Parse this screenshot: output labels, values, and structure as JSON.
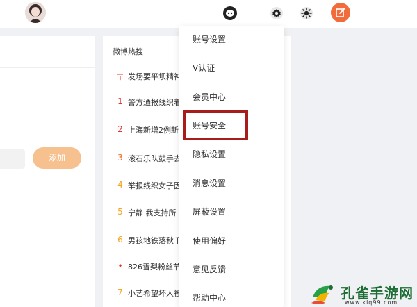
{
  "colors": {
    "accent": "#f26b3a",
    "add_button": "#f7c08f",
    "rank_color": "#f5a623",
    "top_rank": "#e2362d",
    "highlight_border": "#a81c1c",
    "watermark_green": "#1c6d33"
  },
  "topbar": {
    "icons": [
      "avatar",
      "message-icon",
      "gear-icon",
      "sun-icon",
      "compose-icon"
    ]
  },
  "left_panel": {
    "add_label": "添加"
  },
  "hot_search": {
    "title": "微博热搜",
    "items": [
      {
        "rank": "〒",
        "text": "发场要平坝精神"
      },
      {
        "rank": "1",
        "text": "警方通报线织着"
      },
      {
        "rank": "2",
        "text": "上海新增2例新"
      },
      {
        "rank": "3",
        "text": "滚石乐队鼓手去"
      },
      {
        "rank": "4",
        "text": "举报线织女子因"
      },
      {
        "rank": "5",
        "text": "宁静 我支持所"
      },
      {
        "rank": "6",
        "text": "男孩地铁落秋千"
      },
      {
        "rank": "•",
        "text": "826雪梨粉丝节"
      },
      {
        "rank": "7",
        "text": "小艺希望坏人被"
      }
    ]
  },
  "dropdown": {
    "items": [
      "账号设置",
      "V认证",
      "会员中心",
      "账号安全",
      "隐私设置",
      "消息设置",
      "屏蔽设置",
      "使用偏好",
      "意见反馈",
      "帮助中心"
    ],
    "highlighted_index": 3
  },
  "watermark": {
    "name": "孔雀手游网",
    "url": "www.klq99.com"
  }
}
